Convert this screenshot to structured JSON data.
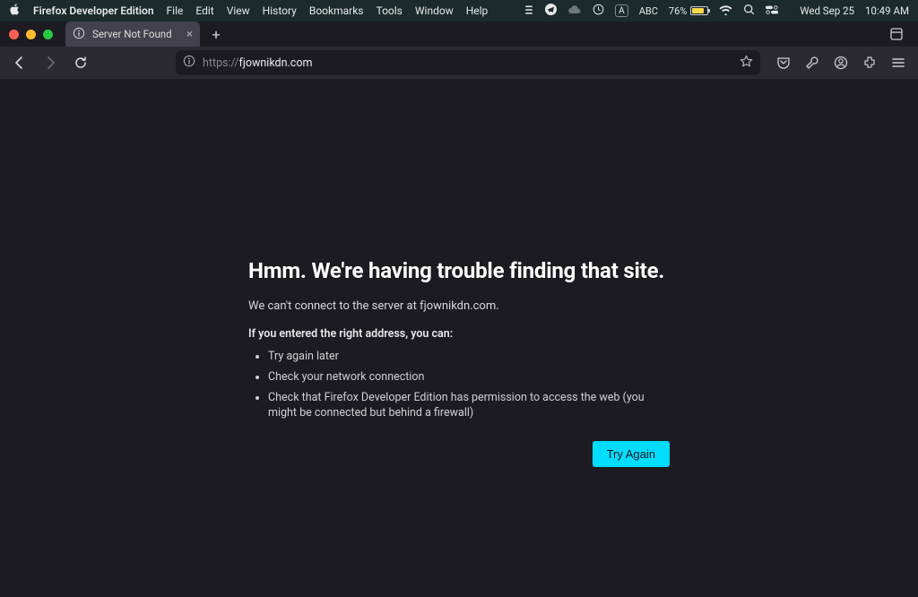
{
  "menubar": {
    "app_name": "Firefox Developer Edition",
    "items": [
      "File",
      "Edit",
      "View",
      "History",
      "Bookmarks",
      "Tools",
      "Window",
      "Help"
    ],
    "right": {
      "input_mode": "A",
      "input_label": "ABC",
      "battery_pct": "76%",
      "date": "Wed Sep 25",
      "time": "10:49 AM"
    }
  },
  "tab": {
    "title": "Server Not Found"
  },
  "url": {
    "scheme": "https://",
    "host": "fjownikdn.com"
  },
  "error": {
    "heading": "Hmm. We're having trouble finding that site.",
    "subtext": "We can't connect to the server at fjownikdn.com.",
    "hint_heading": "If you entered the right address, you can:",
    "bullets": [
      "Try again later",
      "Check your network connection",
      "Check that Firefox Developer Edition has permission to access the web (you might be connected but behind a firewall)"
    ],
    "button": "Try Again"
  }
}
